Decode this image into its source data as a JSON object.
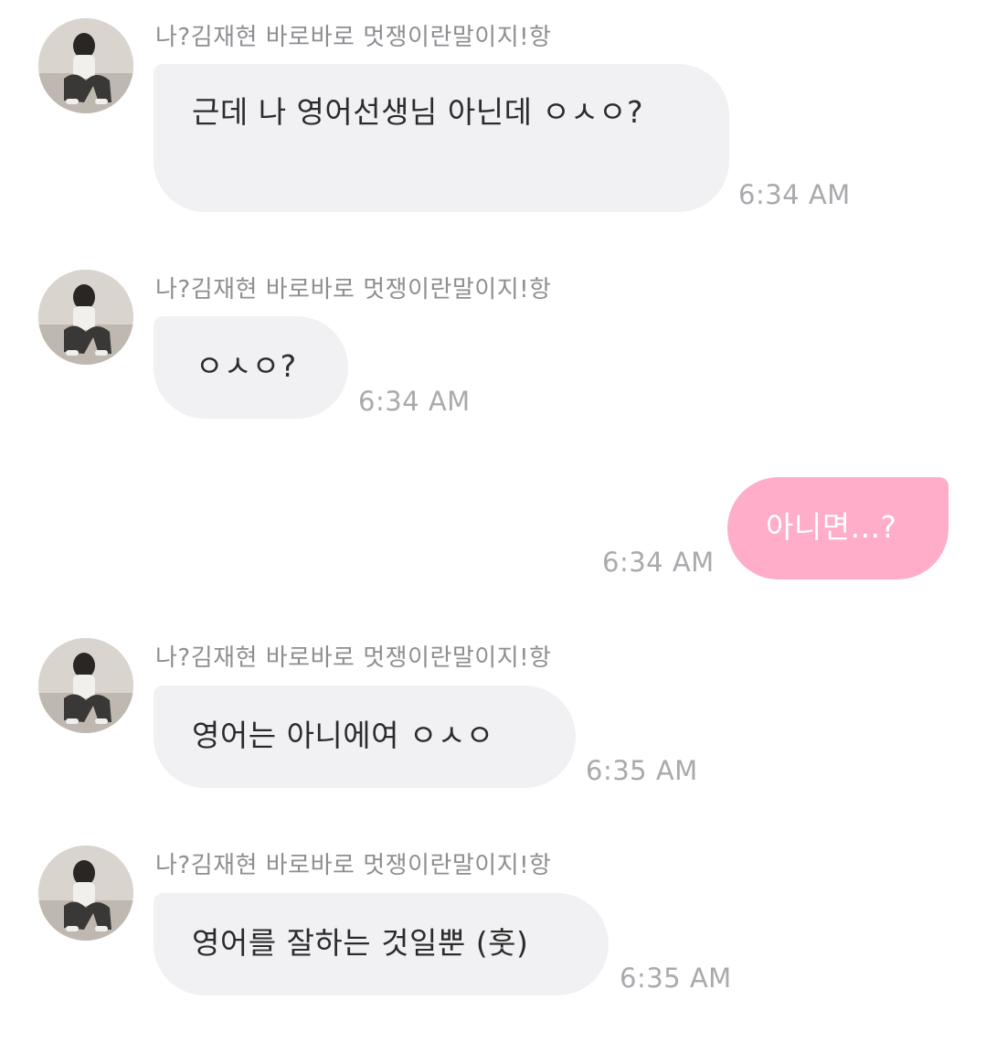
{
  "chat": {
    "messages": [
      {
        "sender": "나?김재현 바로바로 멋쟁이란말이지!항",
        "avatar_icon": "profile-photo",
        "text": "근데 나 영어선생님 아닌데 ㅇㅅㅇ?",
        "time": "6:34 AM",
        "direction": "incoming"
      },
      {
        "sender": "나?김재현 바로바로 멋쟁이란말이지!항",
        "avatar_icon": "profile-photo",
        "text": "ㅇㅅㅇ?",
        "time": "6:34 AM",
        "direction": "incoming"
      },
      {
        "text": "아니면...?",
        "time": "6:34 AM",
        "direction": "outgoing",
        "bubble_color": "#ffadc9"
      },
      {
        "sender": "나?김재현 바로바로 멋쟁이란말이지!항",
        "avatar_icon": "profile-photo",
        "text": "영어는 아니에여 ㅇㅅㅇ",
        "time": "6:35 AM",
        "direction": "incoming"
      },
      {
        "sender": "나?김재현 바로바로 멋쟁이란말이지!항",
        "avatar_icon": "profile-photo",
        "text": "영어를 잘하는 것일뿐 (훗)",
        "time": "6:35 AM",
        "direction": "incoming"
      }
    ]
  },
  "colors": {
    "incoming_bubble": "#f1f1f4",
    "outgoing_bubble": "#ffadc9",
    "timestamp": "#a9a9ae",
    "sender_name": "#8e8e93"
  }
}
